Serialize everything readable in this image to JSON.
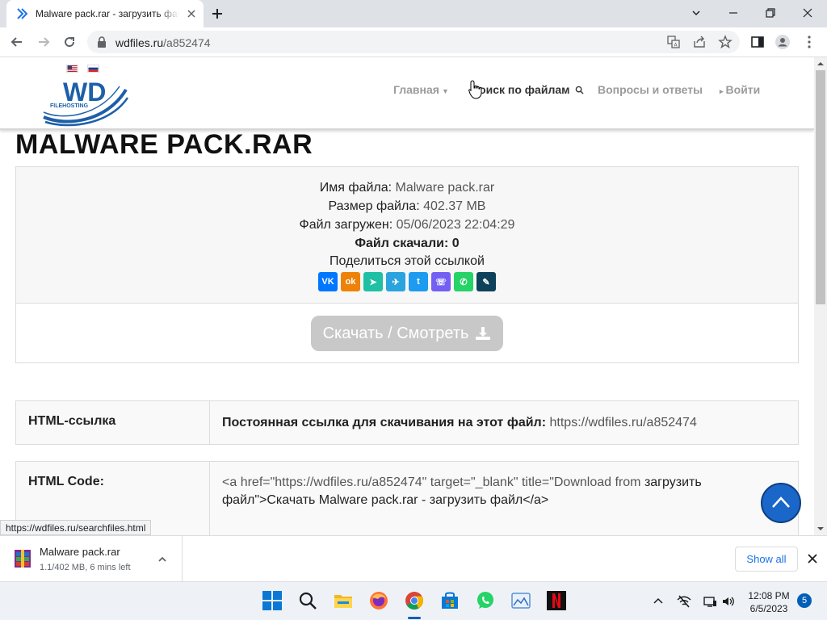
{
  "browser": {
    "tab_title": "Malware pack.rar - загрузить файл",
    "url_host": "wdfiles.ru",
    "url_path": "/a852474"
  },
  "site": {
    "logo_text": "WD",
    "logo_sub": "FILEHOSTING",
    "nav": {
      "home": "Главная",
      "search": "Поиск по файлам",
      "faq": "Вопросы и ответы",
      "login": "Войти"
    },
    "title": "MALWARE PACK.RAR"
  },
  "file": {
    "name_label": "Имя файла:",
    "name_value": "Malware pack.rar",
    "size_label": "Размер файла:",
    "size_value": "402.37 MB",
    "uploaded_label": "Файл загружен:",
    "uploaded_value": "05/06/2023 22:04:29",
    "downloads": "Файл скачали: 0",
    "share_label": "Поделиться этой ссылкой",
    "download_button": "Скачать / Смотреть"
  },
  "share_buttons": [
    {
      "name": "vk",
      "glyph": "VK",
      "color": "#0077ff"
    },
    {
      "name": "odnoklassniki",
      "glyph": "ok",
      "color": "#ee8208"
    },
    {
      "name": "yandex-messenger",
      "glyph": "➤",
      "color": "#1fc0a3"
    },
    {
      "name": "telegram",
      "glyph": "✈",
      "color": "#2aa3df"
    },
    {
      "name": "twitter",
      "glyph": "t",
      "color": "#1d9bf0"
    },
    {
      "name": "viber",
      "glyph": "☏",
      "color": "#7360f2"
    },
    {
      "name": "whatsapp",
      "glyph": "✆",
      "color": "#25d366"
    },
    {
      "name": "livejournal",
      "glyph": "✎",
      "color": "#0d425a"
    }
  ],
  "links_table": [
    {
      "label": "HTML-ссылка",
      "prefix": "Постоянная ссылка для скачивания на этот файл:",
      "value": "https://wdfiles.ru/a852474"
    },
    {
      "label": "HTML Code:",
      "code_part1": "<a href=\"https://wdfiles.ru/a852474\" target=\"_blank\" title=\"Download from",
      "code_part2": "загрузить",
      "code_part3": "файл\">Скачать Malware pack.rar - загрузить файл</a>"
    }
  ],
  "status_url": "https://wdfiles.ru/searchfiles.html",
  "download_shelf": {
    "file_name": "Malware pack.rar",
    "progress_text": "1.1/402 MB, 6 mins left",
    "show_all": "Show all"
  },
  "taskbar": {
    "time": "12:08 PM",
    "date": "6/5/2023",
    "notifications": "5"
  }
}
